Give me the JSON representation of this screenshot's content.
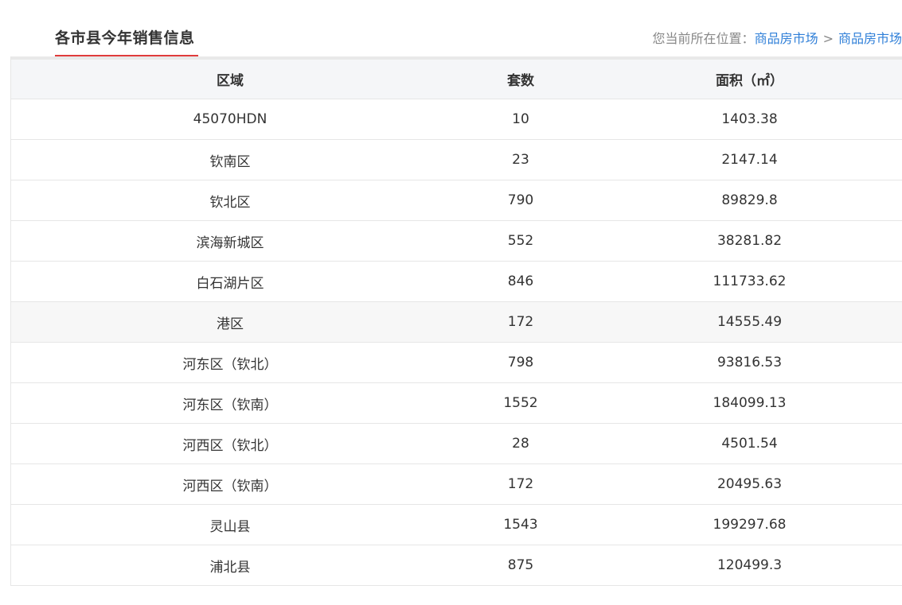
{
  "header": {
    "title": "各市县今年销售信息",
    "breadcrumb": {
      "prefix": "您当前所在位置：",
      "crumb_1": "商品房市场",
      "separator": ">",
      "crumb_2": "商品房市场"
    }
  },
  "table": {
    "columns": [
      "区域",
      "套数",
      "面积（㎡）"
    ],
    "rows": [
      [
        "45070HDN",
        "10",
        "1403.38"
      ],
      [
        "钦南区",
        "23",
        "2147.14"
      ],
      [
        "钦北区",
        "790",
        "89829.8"
      ],
      [
        "滨海新城区",
        "552",
        "38281.82"
      ],
      [
        "白石湖片区",
        "846",
        "111733.62"
      ],
      [
        "港区",
        "172",
        "14555.49"
      ],
      [
        "河东区（钦北）",
        "798",
        "93816.53"
      ],
      [
        "河东区（钦南）",
        "1552",
        "184099.13"
      ],
      [
        "河西区（钦北）",
        "28",
        "4501.54"
      ],
      [
        "河西区（钦南）",
        "172",
        "20495.63"
      ],
      [
        "灵山县",
        "1543",
        "199297.68"
      ],
      [
        "浦北县",
        "875",
        "120499.3"
      ]
    ]
  },
  "colors": {
    "accent_red": "#e03c3c",
    "link_blue": "#2f7fd8"
  }
}
